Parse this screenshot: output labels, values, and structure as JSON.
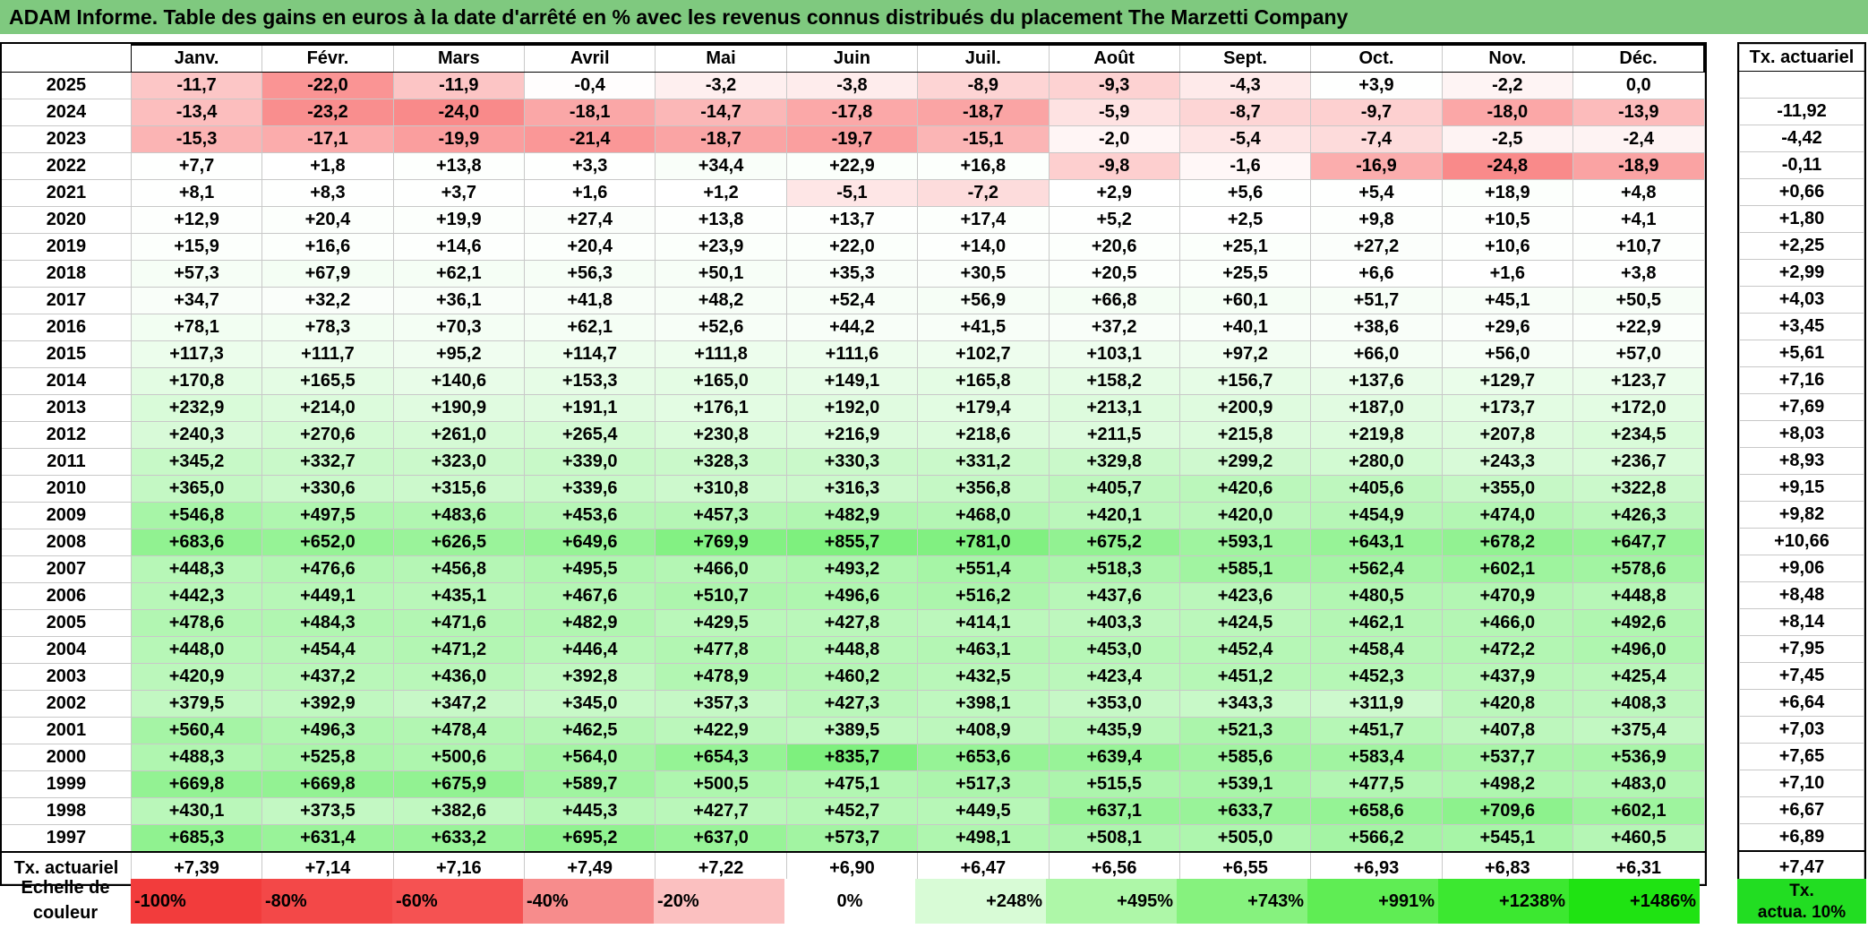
{
  "title": "ADAM Informe. Table des gains en euros à la date d'arrêté en % avec les revenus connus distribués du placement The Marzetti Company",
  "months": [
    "Janv.",
    "Févr.",
    "Mars",
    "Avril",
    "Mai",
    "Juin",
    "Juil.",
    "Août",
    "Sept.",
    "Oct.",
    "Nov.",
    "Déc."
  ],
  "side_header": "Tx. actuariel",
  "rows": [
    {
      "year": "2025",
      "values": [
        "-11,7",
        "-22,0",
        "-11,9",
        "-0,4",
        "-3,2",
        "-3,8",
        "-8,9",
        "-9,3",
        "-4,3",
        "+3,9",
        "-2,2",
        "0,0"
      ],
      "rate": ""
    },
    {
      "year": "2024",
      "values": [
        "-13,4",
        "-23,2",
        "-24,0",
        "-18,1",
        "-14,7",
        "-17,8",
        "-18,7",
        "-5,9",
        "-8,7",
        "-9,7",
        "-18,0",
        "-13,9"
      ],
      "rate": "-11,92"
    },
    {
      "year": "2023",
      "values": [
        "-15,3",
        "-17,1",
        "-19,9",
        "-21,4",
        "-18,7",
        "-19,7",
        "-15,1",
        "-2,0",
        "-5,4",
        "-7,4",
        "-2,5",
        "-2,4"
      ],
      "rate": "-4,42"
    },
    {
      "year": "2022",
      "values": [
        "+7,7",
        "+1,8",
        "+13,8",
        "+3,3",
        "+34,4",
        "+22,9",
        "+16,8",
        "-9,8",
        "-1,6",
        "-16,9",
        "-24,8",
        "-18,9"
      ],
      "rate": "-0,11"
    },
    {
      "year": "2021",
      "values": [
        "+8,1",
        "+8,3",
        "+3,7",
        "+1,6",
        "+1,2",
        "-5,1",
        "-7,2",
        "+2,9",
        "+5,6",
        "+5,4",
        "+18,9",
        "+4,8"
      ],
      "rate": "+0,66"
    },
    {
      "year": "2020",
      "values": [
        "+12,9",
        "+20,4",
        "+19,9",
        "+27,4",
        "+13,8",
        "+13,7",
        "+17,4",
        "+5,2",
        "+2,5",
        "+9,8",
        "+10,5",
        "+4,1"
      ],
      "rate": "+1,80"
    },
    {
      "year": "2019",
      "values": [
        "+15,9",
        "+16,6",
        "+14,6",
        "+20,4",
        "+23,9",
        "+22,0",
        "+14,0",
        "+20,6",
        "+25,1",
        "+27,2",
        "+10,6",
        "+10,7"
      ],
      "rate": "+2,25"
    },
    {
      "year": "2018",
      "values": [
        "+57,3",
        "+67,9",
        "+62,1",
        "+56,3",
        "+50,1",
        "+35,3",
        "+30,5",
        "+20,5",
        "+25,5",
        "+6,6",
        "+1,6",
        "+3,8"
      ],
      "rate": "+2,99"
    },
    {
      "year": "2017",
      "values": [
        "+34,7",
        "+32,2",
        "+36,1",
        "+41,8",
        "+48,2",
        "+52,4",
        "+56,9",
        "+66,8",
        "+60,1",
        "+51,7",
        "+45,1",
        "+50,5"
      ],
      "rate": "+4,03"
    },
    {
      "year": "2016",
      "values": [
        "+78,1",
        "+78,3",
        "+70,3",
        "+62,1",
        "+52,6",
        "+44,2",
        "+41,5",
        "+37,2",
        "+40,1",
        "+38,6",
        "+29,6",
        "+22,9"
      ],
      "rate": "+3,45"
    },
    {
      "year": "2015",
      "values": [
        "+117,3",
        "+111,7",
        "+95,2",
        "+114,7",
        "+111,8",
        "+111,6",
        "+102,7",
        "+103,1",
        "+97,2",
        "+66,0",
        "+56,0",
        "+57,0"
      ],
      "rate": "+5,61"
    },
    {
      "year": "2014",
      "values": [
        "+170,8",
        "+165,5",
        "+140,6",
        "+153,3",
        "+165,0",
        "+149,1",
        "+165,8",
        "+158,2",
        "+156,7",
        "+137,6",
        "+129,7",
        "+123,7"
      ],
      "rate": "+7,16"
    },
    {
      "year": "2013",
      "values": [
        "+232,9",
        "+214,0",
        "+190,9",
        "+191,1",
        "+176,1",
        "+192,0",
        "+179,4",
        "+213,1",
        "+200,9",
        "+187,0",
        "+173,7",
        "+172,0"
      ],
      "rate": "+7,69"
    },
    {
      "year": "2012",
      "values": [
        "+240,3",
        "+270,6",
        "+261,0",
        "+265,4",
        "+230,8",
        "+216,9",
        "+218,6",
        "+211,5",
        "+215,8",
        "+219,8",
        "+207,8",
        "+234,5"
      ],
      "rate": "+8,03"
    },
    {
      "year": "2011",
      "values": [
        "+345,2",
        "+332,7",
        "+323,0",
        "+339,0",
        "+328,3",
        "+330,3",
        "+331,2",
        "+329,8",
        "+299,2",
        "+280,0",
        "+243,3",
        "+236,7"
      ],
      "rate": "+8,93"
    },
    {
      "year": "2010",
      "values": [
        "+365,0",
        "+330,6",
        "+315,6",
        "+339,6",
        "+310,8",
        "+316,3",
        "+356,8",
        "+405,7",
        "+420,6",
        "+405,6",
        "+355,0",
        "+322,8"
      ],
      "rate": "+9,15"
    },
    {
      "year": "2009",
      "values": [
        "+546,8",
        "+497,5",
        "+483,6",
        "+453,6",
        "+457,3",
        "+482,9",
        "+468,0",
        "+420,1",
        "+420,0",
        "+454,9",
        "+474,0",
        "+426,3"
      ],
      "rate": "+9,82"
    },
    {
      "year": "2008",
      "values": [
        "+683,6",
        "+652,0",
        "+626,5",
        "+649,6",
        "+769,9",
        "+855,7",
        "+781,0",
        "+675,2",
        "+593,1",
        "+643,1",
        "+678,2",
        "+647,7"
      ],
      "rate": "+10,66"
    },
    {
      "year": "2007",
      "values": [
        "+448,3",
        "+476,6",
        "+456,8",
        "+495,5",
        "+466,0",
        "+493,2",
        "+551,4",
        "+518,3",
        "+585,1",
        "+562,4",
        "+602,1",
        "+578,6"
      ],
      "rate": "+9,06"
    },
    {
      "year": "2006",
      "values": [
        "+442,3",
        "+449,1",
        "+435,1",
        "+467,6",
        "+510,7",
        "+496,6",
        "+516,2",
        "+437,6",
        "+423,6",
        "+480,5",
        "+470,9",
        "+448,8"
      ],
      "rate": "+8,48"
    },
    {
      "year": "2005",
      "values": [
        "+478,6",
        "+484,3",
        "+471,6",
        "+482,9",
        "+429,5",
        "+427,8",
        "+414,1",
        "+403,3",
        "+424,5",
        "+462,1",
        "+466,0",
        "+492,6"
      ],
      "rate": "+8,14"
    },
    {
      "year": "2004",
      "values": [
        "+448,0",
        "+454,4",
        "+471,2",
        "+446,4",
        "+477,8",
        "+448,8",
        "+463,1",
        "+453,0",
        "+452,4",
        "+458,4",
        "+472,2",
        "+496,0"
      ],
      "rate": "+7,95"
    },
    {
      "year": "2003",
      "values": [
        "+420,9",
        "+437,2",
        "+436,0",
        "+392,8",
        "+478,9",
        "+460,2",
        "+432,5",
        "+423,4",
        "+451,2",
        "+452,3",
        "+437,9",
        "+425,4"
      ],
      "rate": "+7,45"
    },
    {
      "year": "2002",
      "values": [
        "+379,5",
        "+392,9",
        "+347,2",
        "+345,0",
        "+357,3",
        "+427,3",
        "+398,1",
        "+353,0",
        "+343,3",
        "+311,9",
        "+420,8",
        "+408,3"
      ],
      "rate": "+6,64"
    },
    {
      "year": "2001",
      "values": [
        "+560,4",
        "+496,3",
        "+478,4",
        "+462,5",
        "+422,9",
        "+389,5",
        "+408,9",
        "+435,9",
        "+521,3",
        "+451,7",
        "+407,8",
        "+375,4"
      ],
      "rate": "+7,03"
    },
    {
      "year": "2000",
      "values": [
        "+488,3",
        "+525,8",
        "+500,6",
        "+564,0",
        "+654,3",
        "+835,7",
        "+653,6",
        "+639,4",
        "+585,6",
        "+583,4",
        "+537,7",
        "+536,9"
      ],
      "rate": "+7,65"
    },
    {
      "year": "1999",
      "values": [
        "+669,8",
        "+669,8",
        "+675,9",
        "+589,7",
        "+500,5",
        "+475,1",
        "+517,3",
        "+515,5",
        "+539,1",
        "+477,5",
        "+498,2",
        "+483,0"
      ],
      "rate": "+7,10"
    },
    {
      "year": "1998",
      "values": [
        "+430,1",
        "+373,5",
        "+382,6",
        "+445,3",
        "+427,7",
        "+452,7",
        "+449,5",
        "+637,1",
        "+633,7",
        "+658,6",
        "+709,6",
        "+602,1"
      ],
      "rate": "+6,67"
    },
    {
      "year": "1997",
      "values": [
        "+685,3",
        "+631,4",
        "+633,2",
        "+695,2",
        "+637,0",
        "+573,7",
        "+498,1",
        "+508,1",
        "+505,0",
        "+566,2",
        "+545,1",
        "+460,5"
      ],
      "rate": "+6,89"
    }
  ],
  "footer": {
    "label": "Tx. actuariel",
    "values": [
      "+7,39",
      "+7,14",
      "+7,16",
      "+7,49",
      "+7,22",
      "+6,90",
      "+6,47",
      "+6,56",
      "+6,55",
      "+6,93",
      "+6,83",
      "+6,31"
    ],
    "total": "+7,47"
  },
  "legend": {
    "label_line1": "Echelle de",
    "label_line2": "couleur",
    "items": [
      {
        "label": "-100%",
        "color": "#f23c3c",
        "align": "left"
      },
      {
        "label": "-80%",
        "color": "#f34848",
        "align": "left"
      },
      {
        "label": "-60%",
        "color": "#f55252",
        "align": "left"
      },
      {
        "label": "-40%",
        "color": "#f78c8c",
        "align": "left"
      },
      {
        "label": "-20%",
        "color": "#fbc0c0",
        "align": "left"
      },
      {
        "label": "0%",
        "color": "#ffffff",
        "align": "center"
      },
      {
        "label": "+248%",
        "color": "#d8fbd6",
        "align": "right"
      },
      {
        "label": "+495%",
        "color": "#aef7a8",
        "align": "right"
      },
      {
        "label": "+743%",
        "color": "#86f27e",
        "align": "right"
      },
      {
        "label": "+991%",
        "color": "#5fed54",
        "align": "right"
      },
      {
        "label": "+1238%",
        "color": "#3ce830",
        "align": "right"
      },
      {
        "label": "+1486%",
        "color": "#1fe312",
        "align": "right"
      }
    ],
    "side_line1": "Tx.",
    "side_line2": "actua. 10%",
    "side_color": "#22dd22"
  },
  "colors": {
    "title_bg": "#7fc97f",
    "neg_strong": "#f98a8a",
    "pos_strong": "#7ef07e"
  }
}
